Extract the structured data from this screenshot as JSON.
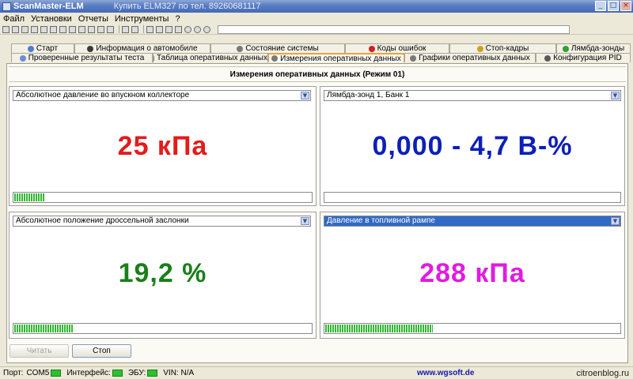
{
  "window": {
    "title": "ScanMaster-ELM",
    "promo": "Купить ELM327 по тел. 89260681117",
    "buttons": {
      "minimize": "_",
      "maximize": "□",
      "close": "×"
    }
  },
  "menu": [
    "Файл",
    "Установки",
    "Отчеты",
    "Инструменты",
    "?"
  ],
  "tabs": {
    "row1": [
      {
        "label": "Старт",
        "icon_color": "#4a7fd0"
      },
      {
        "label": "Информация о автомобиле",
        "icon_color": "#3a3a3a"
      },
      {
        "label": "Состояние системы",
        "icon_color": "#7a7a7a"
      },
      {
        "label": "Коды ошибок",
        "icon_color": "#d02020"
      },
      {
        "label": "Стоп-кадры",
        "icon_color": "#d0a020"
      },
      {
        "label": "Лямбда-зонды",
        "icon_color": "#30a030"
      }
    ],
    "row2": [
      {
        "label": "Проверенные результаты теста",
        "icon_color": "#6a8fd0"
      },
      {
        "label": "Таблица оперативных данных",
        "icon_color": "#7a7a7a"
      },
      {
        "label": "Измерения оперативных данных",
        "icon_color": "#7a7a7a",
        "active": true
      },
      {
        "label": "Графики оперативных данных",
        "icon_color": "#7a7a7a"
      },
      {
        "label": "Конфигурация PID",
        "icon_color": "#5a5a5a"
      }
    ]
  },
  "main": {
    "title": "Измерения оперативных данных (Режим 01)",
    "gauges": [
      {
        "pid": "Абсолютное давление во впускном коллекторе",
        "value": "25 кПа",
        "color": "#e41b1b",
        "fill": 0.105,
        "selected": false
      },
      {
        "pid": "Лямбда-зонд 1, Банк 1",
        "value": "0,000 - 4,7 В-%",
        "color": "#0d1fb8",
        "fill": 0.0,
        "selected": false
      },
      {
        "pid": "Абсолютное положение дроссельной заслонки",
        "value": "19,2 %",
        "color": "#1a7f1a",
        "fill": 0.2,
        "selected": false
      },
      {
        "pid": "Давление в топливной рампе",
        "value": "288 кПа",
        "color": "#e11be1",
        "fill": 0.365,
        "selected": true
      }
    ],
    "read_button": "Читать",
    "stop_button": "Стоп"
  },
  "status": {
    "port_label": "Порт:",
    "port_value": "COM5",
    "interface_label": "Интерфейс:",
    "ecu_label": "ЭБУ:",
    "vin_label": "VIN: N/A",
    "url": "www.wgsoft.de",
    "blog": "citroenblog.ru"
  }
}
